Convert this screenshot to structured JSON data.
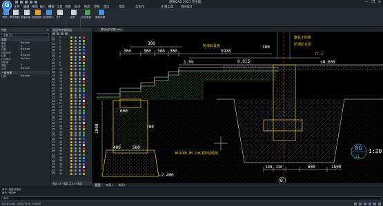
{
  "window": {
    "title": "浩辰CAD 2021 专业版",
    "logo_letter": "G",
    "buttons": [
      "—",
      "❐",
      "✕"
    ]
  },
  "menu": {
    "items": [
      "文件",
      "编辑",
      "视图",
      "插入",
      "格式",
      "工具",
      "绘图",
      "标注",
      "修改",
      "参数",
      "窗口",
      "帮助",
      "云协作",
      "扩展工具",
      "协同设计"
    ],
    "active_index": 4
  },
  "ribbon": {
    "buttons": [
      {
        "label": "帮助",
        "color": "#4a90d9"
      },
      {
        "label": "教学视频",
        "color": "#c9d1da"
      },
      {
        "label": "新增功能",
        "color": "#c9d1da"
      },
      {
        "label": "如何使用",
        "color": "#e0a030"
      },
      {
        "label": "在线提问",
        "color": "#4a90d9"
      },
      {
        "label": "关于",
        "color": "#c9d1da"
      },
      {
        "label": "注册",
        "color": "#c9d1da"
      },
      {
        "label": "检查更新",
        "color": "#4aa05a"
      },
      {
        "label": "更新设置",
        "color": "#4a90d9"
      }
    ],
    "groups": [
      "帮助",
      "注册",
      "软件更新"
    ]
  },
  "left_panel": {
    "title": "特性",
    "select_value": "全部 (1)",
    "sections": [
      {
        "title": "常规",
        "rows": [
          {
            "k": "颜色",
            "v": "ByLayer"
          },
          {
            "k": "图层",
            "v": "0"
          },
          {
            "k": "线型",
            "v": "ByLayer"
          },
          {
            "k": "线型比例",
            "v": "1"
          },
          {
            "k": "线宽",
            "v": "ByLayer"
          },
          {
            "k": "打印样式",
            "v": "ByColor"
          },
          {
            "k": "超链接",
            "v": ""
          },
          {
            "k": "厚度",
            "v": "0"
          },
          {
            "k": "材质",
            "v": "ByLayer"
          }
        ]
      },
      {
        "title": "三维效果",
        "rows": [
          {
            "k": "材质",
            "v": "ByLayer"
          }
        ]
      }
    ]
  },
  "layer_panel": {
    "title": "图层特性管理器",
    "layers": [
      "0",
      "1",
      "2",
      "3",
      "4",
      "5",
      "6",
      "7",
      "8",
      "9",
      "10",
      "11",
      "12",
      "13",
      "14",
      "15",
      "16",
      "17",
      "18",
      "19",
      "20",
      "21",
      "22",
      "23",
      "24",
      "25",
      "26",
      "27",
      "28",
      "29",
      "30",
      "31",
      "32",
      "33",
      "34",
      "35",
      "36",
      "37",
      "38",
      "39",
      "40",
      "41",
      "42",
      "43"
    ],
    "dot_colors": [
      "#e04040",
      "#e0c020",
      "#40c040",
      "#40c0e0",
      "#4060e0",
      "#e040e0",
      "#ffffff"
    ],
    "footer": "全部: 44 个图层 共 44 个图层"
  },
  "document": {
    "tab_label": "基础大样详图.dwg"
  },
  "drawing": {
    "texts": {
      "d300a": "300",
      "d300b": "300",
      "d300c": "300",
      "d300d": "300",
      "d300e": "300",
      "d5920": "5920",
      "d0015": "0.015",
      "slope": "1.0%",
      "d100": "100",
      "note1": "聚氨丁防霉",
      "note2": "防潮石膏板",
      "note3": "防潮防水层",
      "tag_q": "??-2",
      "elev_top": "±0.000",
      "d600": "600",
      "d1000": "1000",
      "d700": "700",
      "d400": "400",
      "d500": "500",
      "note_bot": "MU10砖,M5.0水泥砂浆砌筑",
      "elev_low": "-2.400",
      "d180": "180",
      "d220": "220",
      "d600b": "600",
      "d1500": "1500",
      "axis_b": "B",
      "detail_no": "06",
      "detail_sheet": "11",
      "scale": "1:20"
    }
  },
  "layout_tabs": [
    "模型",
    "布局1",
    "布局2"
  ],
  "command": {
    "lines": [
      "命令: 指定对角点:",
      "命令: *取消*"
    ],
    "input_placeholder": "命令:"
  },
  "status": {
    "coords": "8216.3441, 3260.1792, 0.0000"
  }
}
